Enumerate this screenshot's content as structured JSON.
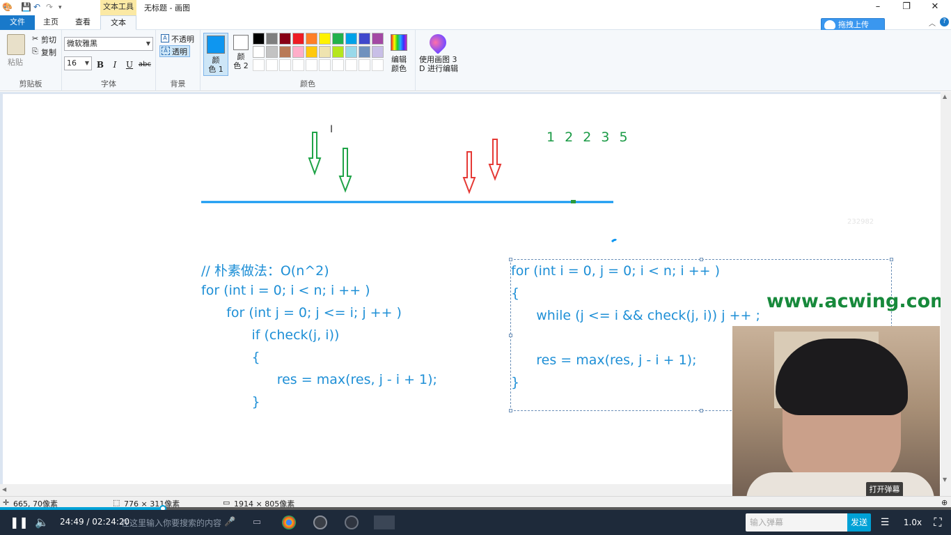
{
  "window": {
    "tool_tab": "文本工具",
    "title": "无标题 - 画图"
  },
  "tabs": {
    "file": "文件",
    "home": "主页",
    "view": "查看",
    "text": "文本"
  },
  "cloud_upload": "拖拽上传",
  "ribbon": {
    "clipboard": {
      "paste": "粘贴",
      "cut": "剪切",
      "copy": "复制",
      "label": "剪贴板"
    },
    "font": {
      "family": "微软雅黑",
      "size": "16",
      "bold": "B",
      "italic": "I",
      "underline": "U",
      "strike": "abc",
      "label": "字体"
    },
    "background": {
      "opaque": "不透明",
      "transparent": "透明",
      "label": "背景"
    },
    "colors": {
      "color1": "颜\n色 1",
      "color2": "颜\n色 2",
      "edit": "编辑\n颜色",
      "paint3d": "使用画图 3\nD 进行编辑",
      "label": "颜色",
      "color1_value": "#0e96f0",
      "color2_value": "#ffffff",
      "row1": [
        "#000000",
        "#7f7f7f",
        "#880015",
        "#ed1c24",
        "#ff7f27",
        "#fff200",
        "#22b14c",
        "#00a2e8",
        "#3f48cc",
        "#a349a4"
      ],
      "row2": [
        "#ffffff",
        "#c3c3c3",
        "#b97a57",
        "#ffaec9",
        "#ffc90e",
        "#efe4b0",
        "#b5e61d",
        "#99d9ea",
        "#7092be",
        "#c8bfe7"
      ]
    }
  },
  "canvas": {
    "numbers": "1 2 2 3 5",
    "left_code": [
      "// 朴素做法：O(n^2)",
      "for (int i = 0; i < n; i ++ )",
      "      for (int j = 0; j <= i; j ++ )",
      "            if (check(j, i))",
      "            {",
      "                  res = max(res, j - i + 1);",
      "            }"
    ],
    "right_code": [
      "for (int i = 0, j = 0; i < n; i ++ )",
      "{",
      "      while (j <= i && check(j, i)) j ++ ;",
      "",
      "      res = max(res, j - i + 1);",
      "}"
    ],
    "watermark": "www.acwing.com",
    "faint_id": "232982"
  },
  "status": {
    "cursor": "665, 70像素",
    "selection": "776 × 311像素",
    "image_size": "1914 × 805像素"
  },
  "player": {
    "time": "24:49 / 02:24:20",
    "search_hint": "在这里输入你要搜索的内容",
    "danmu_toggle": "打开弹幕",
    "danmu_placeholder": "输入弹幕",
    "send": "发送",
    "speed": "1.0x",
    "progress": 0.171
  }
}
